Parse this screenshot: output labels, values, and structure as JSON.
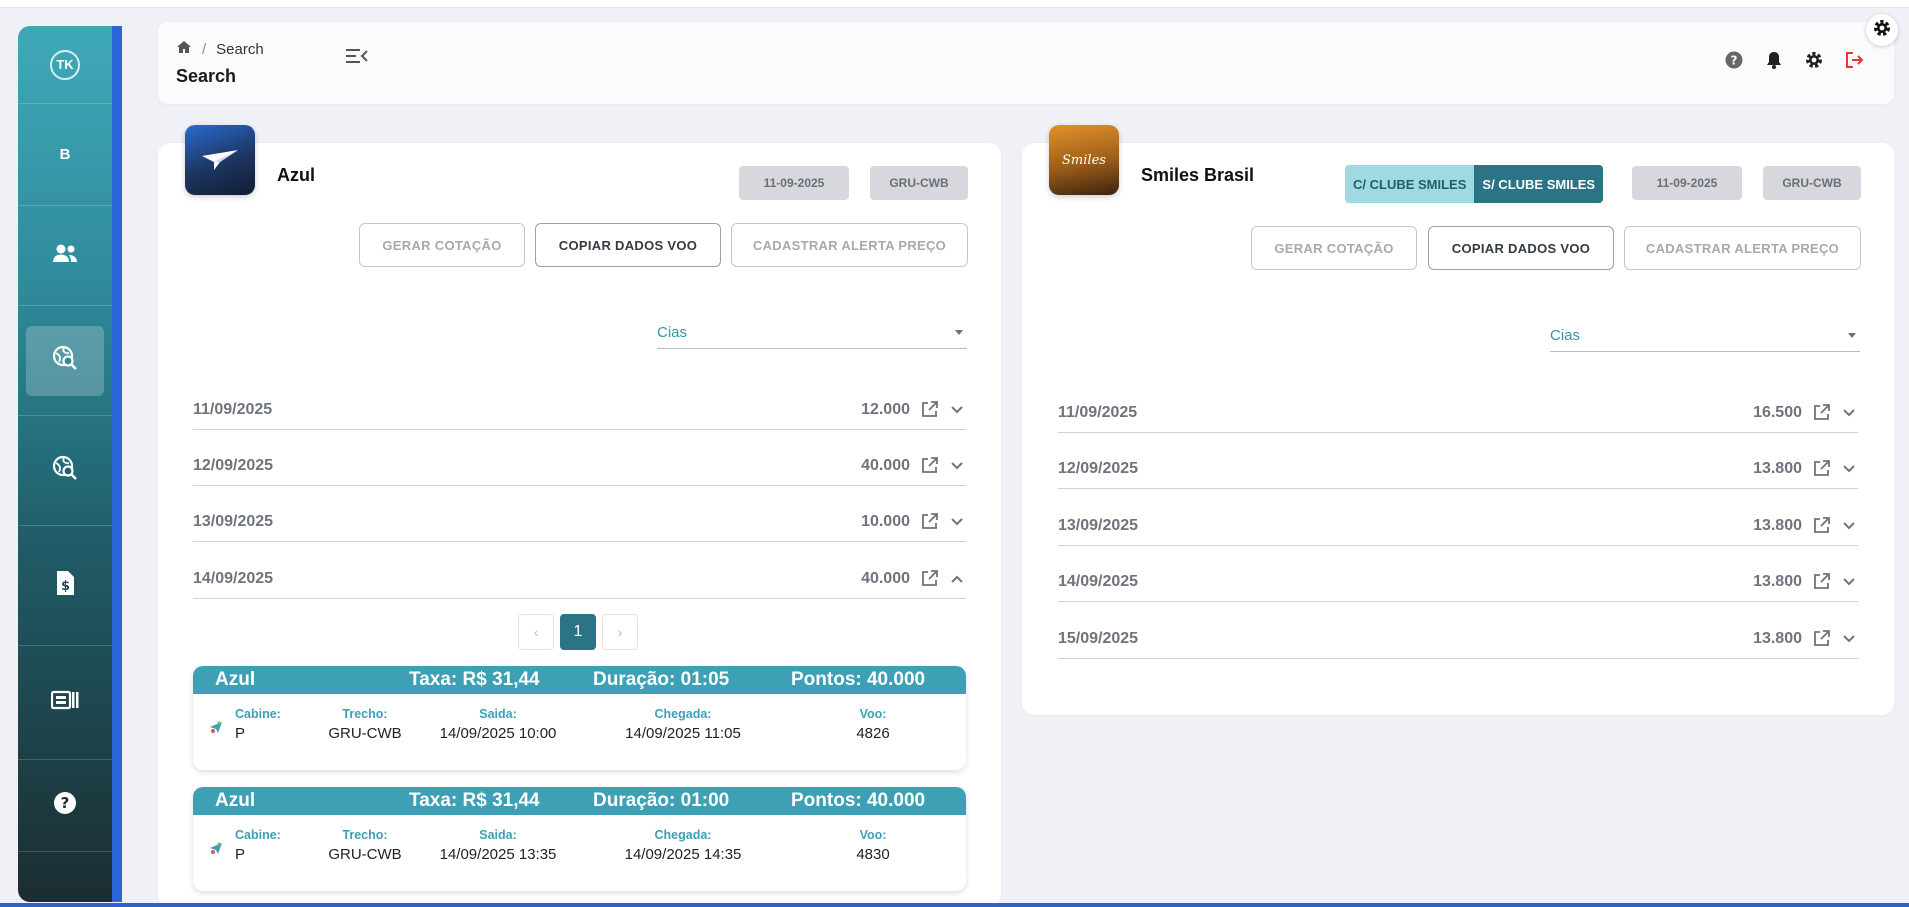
{
  "sidebar": {
    "logo_text": "TK",
    "items": [
      {
        "name": "sidebar-item-b",
        "label": "B"
      },
      {
        "name": "sidebar-item-users",
        "icon": "users-icon"
      },
      {
        "name": "sidebar-item-search",
        "icon": "globe-search-icon"
      },
      {
        "name": "sidebar-item-search-2",
        "icon": "globe-search-icon"
      },
      {
        "name": "sidebar-item-billing",
        "icon": "dollar-document-icon"
      },
      {
        "name": "sidebar-item-reports",
        "icon": "id-card-icon"
      },
      {
        "name": "sidebar-item-help",
        "icon": "help-icon"
      }
    ]
  },
  "header": {
    "breadcrumb_current": "Search",
    "title": "Search",
    "icons": [
      "help-icon",
      "bell-icon",
      "gear-icon",
      "logout-icon"
    ]
  },
  "left": {
    "airline": "Azul",
    "date_chip": "11-09-2025",
    "route_chip": "GRU-CWB",
    "buttons": {
      "quote": "GERAR COTAÇÃO",
      "copy": "COPIAR DADOS VOO",
      "alert": "CADASTRAR ALERTA PREÇO"
    },
    "cias_label": "Cias",
    "rows": [
      {
        "date": "11/09/2025",
        "value": "12.000",
        "expanded": false
      },
      {
        "date": "12/09/2025",
        "value": "40.000",
        "expanded": false
      },
      {
        "date": "13/09/2025",
        "value": "10.000",
        "expanded": false
      },
      {
        "date": "14/09/2025",
        "value": "40.000",
        "expanded": true
      }
    ],
    "pager": {
      "page": "1",
      "prev": "‹",
      "next": "›"
    },
    "labels": {
      "cabin": "Cabine:",
      "route": "Trecho:",
      "dep": "Saida:",
      "arr": "Chegada:",
      "flight": "Voo:"
    },
    "flights": [
      {
        "airline": "Azul",
        "tax": "Taxa: R$ 31,44",
        "duration": "Duração: 01:05",
        "points": "Pontos: 40.000",
        "cabin": "P",
        "route": "GRU-CWB",
        "dep": "14/09/2025 10:00",
        "arr": "14/09/2025 11:05",
        "flight": "4826"
      },
      {
        "airline": "Azul",
        "tax": "Taxa: R$ 31,44",
        "duration": "Duração: 01:00",
        "points": "Pontos: 40.000",
        "cabin": "P",
        "route": "GRU-CWB",
        "dep": "14/09/2025 13:35",
        "arr": "14/09/2025 14:35",
        "flight": "4830"
      }
    ]
  },
  "right": {
    "airline": "Smiles Brasil",
    "logo_text": "Smiles",
    "toggle_with": "C/ CLUBE SMILES",
    "toggle_without": "S/ CLUBE SMILES",
    "date_chip": "11-09-2025",
    "route_chip": "GRU-CWB",
    "buttons": {
      "quote": "GERAR COTAÇÃO",
      "copy": "COPIAR DADOS VOO",
      "alert": "CADASTRAR ALERTA PREÇO"
    },
    "cias_label": "Cias",
    "rows": [
      {
        "date": "11/09/2025",
        "value": "16.500"
      },
      {
        "date": "12/09/2025",
        "value": "13.800"
      },
      {
        "date": "13/09/2025",
        "value": "13.800"
      },
      {
        "date": "14/09/2025",
        "value": "13.800"
      },
      {
        "date": "15/09/2025",
        "value": "13.800"
      }
    ]
  },
  "colors": {
    "accent": "#2a7486",
    "flight_header": "#3ea0b5",
    "sidebar_accent": "#2a64d6"
  }
}
